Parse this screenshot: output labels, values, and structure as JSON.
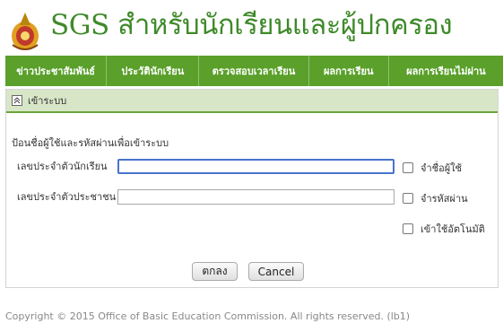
{
  "header": {
    "logo_icon": "thai-school-emblem",
    "title": "SGS สำหรับนักเรียนและผู้ปกครอง"
  },
  "nav": {
    "items": [
      {
        "label": "ข่าวประชาสัมพันธ์"
      },
      {
        "label": "ประวัตินักเรียน"
      },
      {
        "label": "ตรวจสอบเวลาเรียน"
      },
      {
        "label": "ผลการเรียน"
      },
      {
        "label": "ผลการเรียนไม่ผ่าน"
      }
    ]
  },
  "login": {
    "panel_title": "เข้าระบบ",
    "collapse_icon": "chevron-up-icon",
    "instruction": "ป้อนชื่อผู้ใช้และรหัสผ่านเพื่อเข้าระบบ",
    "student_id_label": "เลขประจำตัวนักเรียน",
    "student_id_value": "",
    "citizen_id_label": "เลขประจำตัวประชาชน",
    "citizen_id_value": "",
    "remember_user_label": "จำชื่อผู้ใช้",
    "remember_password_label": "จำรหัสผ่าน",
    "auto_login_label": "เข้าใช้อัตโนมัติ",
    "ok_button": "ตกลง",
    "cancel_button": "Cancel"
  },
  "colors": {
    "nav_background": "#5aa02a",
    "title_green": "#3f8a2a",
    "panel_header_bg": "#d8e6c8"
  },
  "footer": {
    "copyright": "Copyright © 2015 Office of Basic Education Commission. All rights reserved. (lb1)"
  }
}
